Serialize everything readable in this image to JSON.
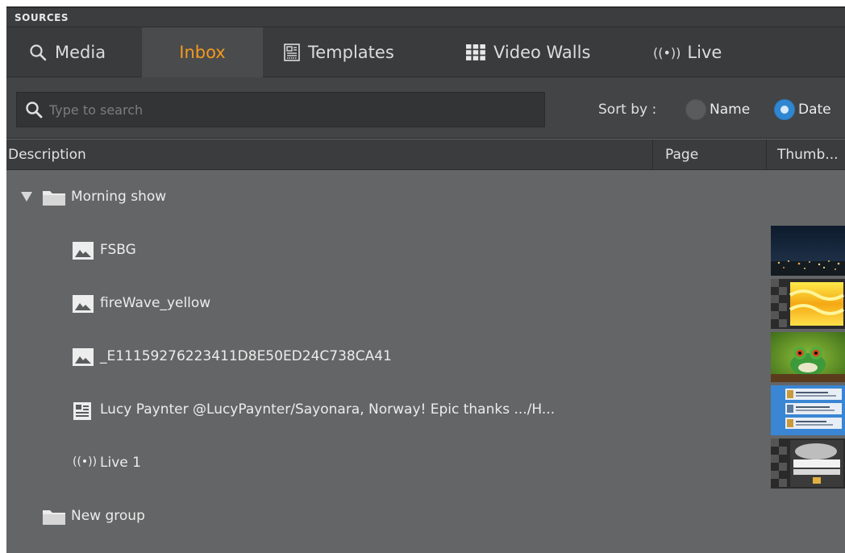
{
  "section": {
    "title": "SOURCES"
  },
  "tabs": [
    {
      "label": "Media",
      "icon": "search-icon",
      "active": false
    },
    {
      "label": "Inbox",
      "icon": "",
      "active": true
    },
    {
      "label": "Templates",
      "icon": "template-icon",
      "active": false
    },
    {
      "label": "Video Walls",
      "icon": "grid-icon",
      "active": false
    },
    {
      "label": "Live",
      "icon": "live-icon",
      "active": false
    }
  ],
  "search": {
    "placeholder": "Type to search",
    "value": ""
  },
  "sort": {
    "label": "Sort by :",
    "options": [
      "Name",
      "Date"
    ],
    "selected": "Date"
  },
  "columns": {
    "description": "Description",
    "page": "Page",
    "thumbnail": "Thumb..."
  },
  "rows": [
    {
      "type": "folder",
      "label": "Morning show",
      "expanded": true,
      "icon": "folder-icon"
    },
    {
      "type": "image",
      "label": "FSBG",
      "icon": "image-icon",
      "thumbnail": "city-night"
    },
    {
      "type": "image",
      "label": "fireWave_yellow",
      "icon": "image-icon",
      "thumbnail": "yellow-wave"
    },
    {
      "type": "image",
      "label": "_E11159276223411D8E50ED24C738CA41",
      "icon": "image-icon",
      "thumbnail": "frog"
    },
    {
      "type": "template",
      "label": "Lucy Paynter @LucyPaynter/Sayonara, Norway! Epic thanks .../H...",
      "icon": "template-icon",
      "thumbnail": "social-post"
    },
    {
      "type": "live",
      "label": "Live 1",
      "icon": "live-icon",
      "thumbnail": "live-feed"
    },
    {
      "type": "folder",
      "label": "New group",
      "expanded": false,
      "icon": "folder-icon"
    }
  ],
  "colors": {
    "accent": "#f39a1e",
    "radio_selected": "#2f87d2",
    "background": "#646566"
  }
}
